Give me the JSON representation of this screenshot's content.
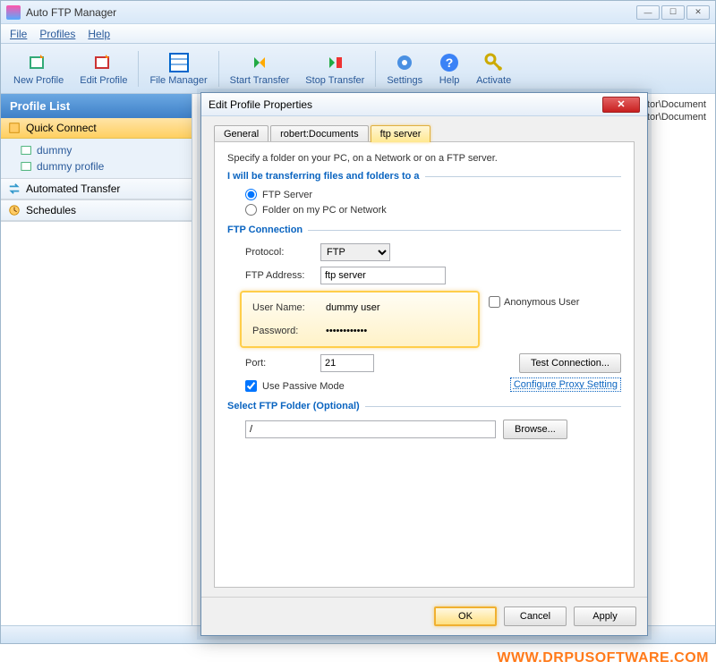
{
  "window": {
    "title": "Auto FTP Manager",
    "menu": {
      "file": "File",
      "profiles": "Profiles",
      "help": "Help"
    },
    "toolbar": {
      "new_profile": "New Profile",
      "edit_profile": "Edit Profile",
      "file_manager": "File Manager",
      "start_transfer": "Start Transfer",
      "stop_transfer": "Stop Transfer",
      "settings": "Settings",
      "help": "Help",
      "activate": "Activate"
    }
  },
  "sidebar": {
    "header": "Profile List",
    "quick_connect": "Quick Connect",
    "items": [
      "dummy",
      "dummy profile"
    ],
    "automated": "Automated Transfer",
    "schedules": "Schedules"
  },
  "main": {
    "row1": "ministrator\\Document",
    "row2": "ministrator\\Document"
  },
  "dialog": {
    "title": "Edit Profile Properties",
    "tabs": {
      "general": "General",
      "robert": "robert:Documents",
      "ftp": "ftp server"
    },
    "desc": "Specify a folder on your PC, on a Network or on a  FTP server.",
    "group_dest": "I will be transferring files and folders to a",
    "radio_ftp": "FTP Server",
    "radio_folder": "Folder on my PC or Network",
    "group_conn": "FTP Connection",
    "protocol_label": "Protocol:",
    "protocol_value": "FTP",
    "addr_label": "FTP Address:",
    "addr_value": "ftp server",
    "user_label": "User Name:",
    "user_value": "dummy user",
    "pass_label": "Password:",
    "pass_value": "············",
    "anon_label": "Anonymous User",
    "port_label": "Port:",
    "port_value": "21",
    "test_btn": "Test Connection...",
    "passive_label": "Use Passive Mode",
    "proxy_link": "Configure Proxy Setting",
    "group_folder": "Select FTP Folder (Optional)",
    "folder_value": "/",
    "browse_btn": "Browse...",
    "ok": "OK",
    "cancel": "Cancel",
    "apply": "Apply"
  },
  "watermark": "WWW.DRPUSOFTWARE.COM"
}
